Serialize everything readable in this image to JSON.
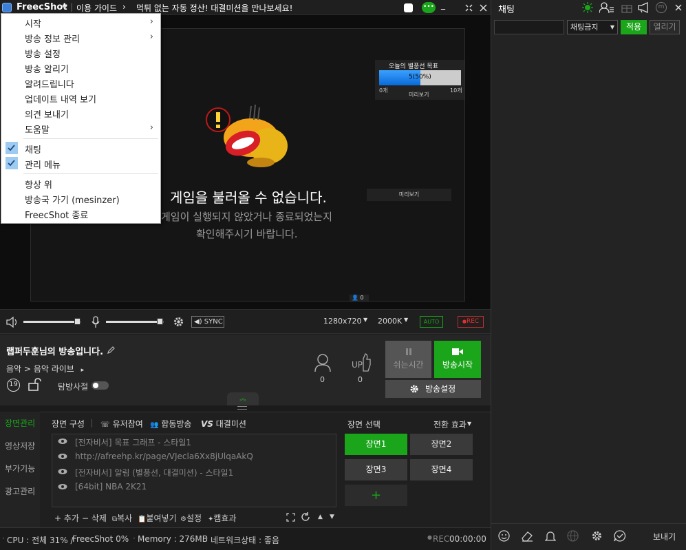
{
  "titlebar": {
    "app_name": "FreecShot",
    "guide": "이용 가이드",
    "separator": "|",
    "notice_arrow": "›",
    "notice": "먹튀 없는 자동 정산! 대결미션을 만나보세요!",
    "min_glyph": "_"
  },
  "menu": {
    "items": [
      {
        "label": "시작",
        "submenu": true
      },
      {
        "label": "방송 정보 관리",
        "submenu": true
      },
      {
        "label": "방송 설정"
      },
      {
        "label": "방송 알리기"
      },
      {
        "label": "알려드립니다"
      },
      {
        "label": "업데이트 내역 보기"
      },
      {
        "label": "의견 보내기"
      },
      {
        "label": "도움말",
        "submenu": true
      },
      {
        "label": "채팅",
        "checked": true
      },
      {
        "label": "관리 메뉴",
        "checked": true
      },
      {
        "label": "항상 위"
      },
      {
        "label": "방송국 가기 (mesinzer)"
      },
      {
        "label": "FreecShot 종료"
      }
    ],
    "arrow_glyph": "›",
    "check_glyph": "✓"
  },
  "preview": {
    "error_title": "게임을 불러올 수 없습니다.",
    "error_line1": "게임이 실행되지 않았거나 종료되었는지",
    "error_line2": "확인해주시기 바랍니다.",
    "widget_title": "오늘의 별풍선 목표",
    "widget_progress_label": "5(50%)",
    "widget_progress": 0.5,
    "widget_min": "0개",
    "widget_max": "10개",
    "widget_preview": "미리보기",
    "preview_label": "미리보기",
    "viewer_count": "0"
  },
  "controls": {
    "sync": "SYNC",
    "resolution": "1280x720",
    "bitrate": "2000K",
    "auto": "AUTO",
    "rec": "REC",
    "rec_dot": "●",
    "speaker_level": 0.95,
    "mic_level": 0.95,
    "dropdown_glyph": "▼"
  },
  "broadcast": {
    "title": "랩퍼두훈님의 방송입니다.",
    "category": "음악",
    "subcategory": "음악 라이브",
    "category_sep": ">",
    "sub_arrow": "▸",
    "age_badge": "19",
    "sneak_label": "탐방사절",
    "viewers": "0",
    "up_label": "UP",
    "up_count": "0",
    "rest_button": "쉬는시간",
    "start_button": "방송시작",
    "settings_button": "방송설정"
  },
  "side_tabs": [
    "장면관리",
    "영상저장",
    "부가기능",
    "광고관리"
  ],
  "scene_compose": {
    "label": "장면 구성",
    "tabs": [
      "유저참여",
      "합동방송",
      "대결미션"
    ],
    "vs_label": "VS",
    "sources": [
      "[전자비서] 목표 그래프 - 스타일1",
      "http://afreehp.kr/page/VJecla6Xx8jUlqaAkQ",
      "[전자비서] 알림 (별풍선, 대결미션) - 스타일1",
      "[64bit] NBA 2K21"
    ],
    "toolbar": [
      "+ 추가",
      "− 삭제",
      "복사",
      "붙여넣기",
      "설정",
      "캠효과"
    ],
    "up_arrow": "▲",
    "down_arrow": "▼"
  },
  "scene_select": {
    "label": "장면 선택",
    "transition": "전환 효과",
    "dropdown_glyph": "▼",
    "scenes": [
      "장면1",
      "장면2",
      "장면3",
      "장면4"
    ],
    "add": "+"
  },
  "statusbar": {
    "cpu": "CPU : 전체 31% /",
    "freecshot": "FreecShot  0%",
    "memory": "Memory : 276MB",
    "network": "네트워크상태 : 좋음",
    "rec_label": "REC",
    "rec_time": "00:00:00"
  },
  "chat": {
    "title": "채팅",
    "ban_select": "채팅금지",
    "apply": "적용",
    "open": "열리기",
    "send": "보내기",
    "input_placeholder": ""
  },
  "colors": {
    "accent_green": "#1aa51a",
    "rec_red": "#e03030",
    "bg": "#1b1b1b"
  }
}
